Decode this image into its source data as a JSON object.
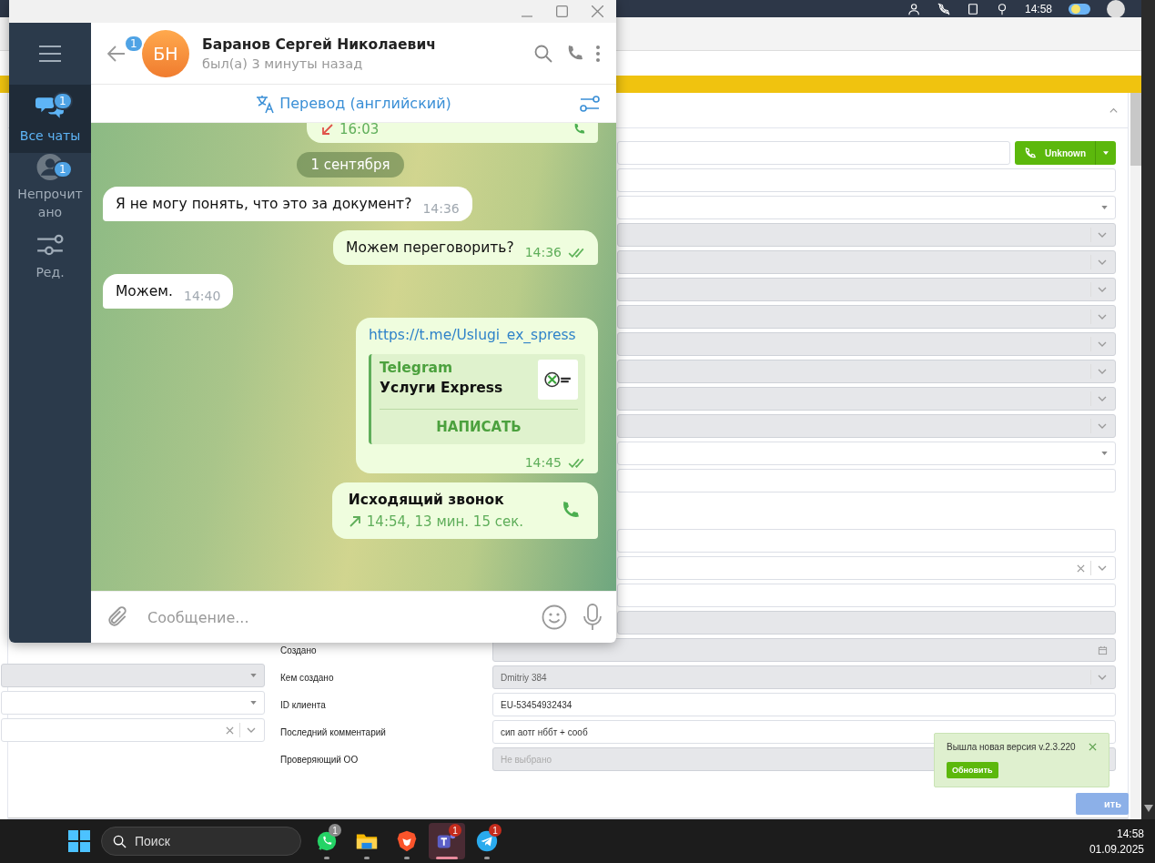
{
  "crm": {
    "top_bar": {
      "time": "14:58"
    },
    "call_button": {
      "label": "Unknown"
    },
    "right_form": [
      [
        {
          "kind": "input",
          "disabled": false
        },
        {
          "kind": "input",
          "disabled": false
        },
        {
          "kind": "select",
          "disabled": false
        },
        {
          "kind": "combo",
          "disabled": true
        },
        {
          "kind": "combo",
          "disabled": true
        },
        {
          "kind": "combo",
          "disabled": true
        },
        {
          "kind": "combo",
          "disabled": true
        },
        {
          "kind": "combo",
          "disabled": true
        },
        {
          "kind": "combo",
          "disabled": true
        },
        {
          "kind": "combo",
          "disabled": true
        },
        {
          "kind": "combo",
          "disabled": true
        },
        {
          "kind": "select",
          "disabled": false
        },
        {
          "kind": "input",
          "disabled": false
        }
      ],
      [
        {
          "kind": "input",
          "disabled": false
        },
        {
          "kind": "combo",
          "disabled": false,
          "clearable": true
        },
        {
          "kind": "input",
          "disabled": false
        },
        {
          "kind": "input",
          "disabled": true
        },
        {
          "kind": "date",
          "disabled": true,
          "label": "Создано"
        },
        {
          "kind": "combo",
          "disabled": true,
          "label": "Кем создано",
          "value": "Dmitriy 384"
        },
        {
          "kind": "input",
          "disabled": false,
          "label": "ID клиента",
          "value": "EU-53454932434"
        },
        {
          "kind": "input",
          "disabled": false,
          "label": "Последний комментарий",
          "value": "сип аотг нббт + сооб"
        },
        {
          "kind": "input",
          "disabled": true,
          "label": "Проверяющий ОО",
          "placeholder": "Не выбрано"
        }
      ]
    ],
    "left_fields": [
      {
        "kind": "select",
        "disabled": true
      },
      {
        "kind": "select",
        "disabled": false
      },
      {
        "kind": "combo",
        "disabled": false,
        "clearable": true
      }
    ],
    "save_button": {
      "label": "ить"
    }
  },
  "telegram": {
    "sidebar": [
      {
        "kind": "chats",
        "label": "Все чаты",
        "badge": "1",
        "selected": true
      },
      {
        "kind": "unread",
        "label": "Непрочитано",
        "badge": "1",
        "selected": false
      },
      {
        "kind": "folders",
        "label": "Ред.",
        "selected": false
      }
    ],
    "header": {
      "back_badge": "1",
      "initials": "БН",
      "name": "Баранов Сергей Николаевич",
      "status": "был(а) 3 минуты назад"
    },
    "translate_bar": {
      "label": "Перевод (английский)"
    },
    "messages": [
      {
        "kind": "call",
        "outgoing": true,
        "missed": true,
        "details": "16:03"
      },
      {
        "kind": "date",
        "text": "1 сентября"
      },
      {
        "kind": "text",
        "outgoing": false,
        "text": "Я не могу понять, что это за документ?",
        "time": "14:36"
      },
      {
        "kind": "text",
        "outgoing": true,
        "text": "Можем переговорить?",
        "time": "14:36",
        "read": true
      },
      {
        "kind": "text",
        "outgoing": false,
        "text": "Можем.",
        "time": "14:40"
      },
      {
        "kind": "link",
        "outgoing": true,
        "url": "https://t.me/Uslugi_ex_spress",
        "site": "Telegram",
        "title": "Услуги Express",
        "button": "НАПИСАТЬ",
        "time": "14:45",
        "read": true
      },
      {
        "kind": "call",
        "outgoing": true,
        "missed": false,
        "title": "Исходящий звонок",
        "details": "14:54, 13 мин. 15 сек."
      }
    ],
    "composer": {
      "placeholder": "Сообщение..."
    }
  },
  "toast": {
    "text": "Вышла новая версия v.2.3.220",
    "button": "Обновить"
  },
  "taskbar": {
    "search_placeholder": "Поиск",
    "apps": [
      {
        "kind": "whatsapp",
        "badge": "1",
        "color": "#8a8a8a",
        "selected": false
      },
      {
        "kind": "folder",
        "selected": false
      },
      {
        "kind": "brave",
        "selected": false
      },
      {
        "kind": "teams",
        "badge": "1",
        "color": "#c42b1c",
        "selected": true
      },
      {
        "kind": "telegram",
        "badge": "1",
        "color": "#c42b1c",
        "selected": false
      }
    ],
    "time": "14:58",
    "date": "01.09.2025"
  }
}
